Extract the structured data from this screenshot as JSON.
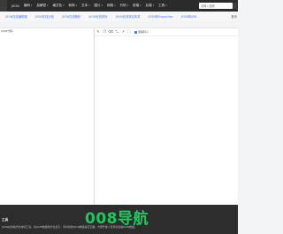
{
  "topnav": {
    "first_item": "JSON",
    "items": [
      "编码",
      "加解密",
      "格式化",
      "转换",
      "文本",
      "图片",
      "网络",
      "代码",
      "前端",
      "后端",
      "工具"
    ],
    "search_placeholder": "请输入搜索"
  },
  "tools": {
    "links": [
      "JSON在线编辑器",
      "JSON在线比较",
      "JSON在线解析",
      "JSON在线排序",
      "JSON在线转实体类",
      "JSON转Properties",
      "JSON转XML"
    ],
    "home_label": "首页"
  },
  "editor": {
    "left_label": "JSON代码",
    "toolbar_icons": [
      "edit-icon",
      "copy-icon",
      "delete-icon",
      "compress-icon",
      "expand-icon",
      "fullscreen-icon"
    ],
    "checkbox_label": "保留转义"
  },
  "footer": {
    "title": "工具",
    "description": "JSON在线格式化校验工具，将JSON数据格式化显示，同时校验JSON数据是否正确，方便开发人员调试查看JSON数据。",
    "brand": "008导航",
    "brand_color": "#22c55e"
  }
}
